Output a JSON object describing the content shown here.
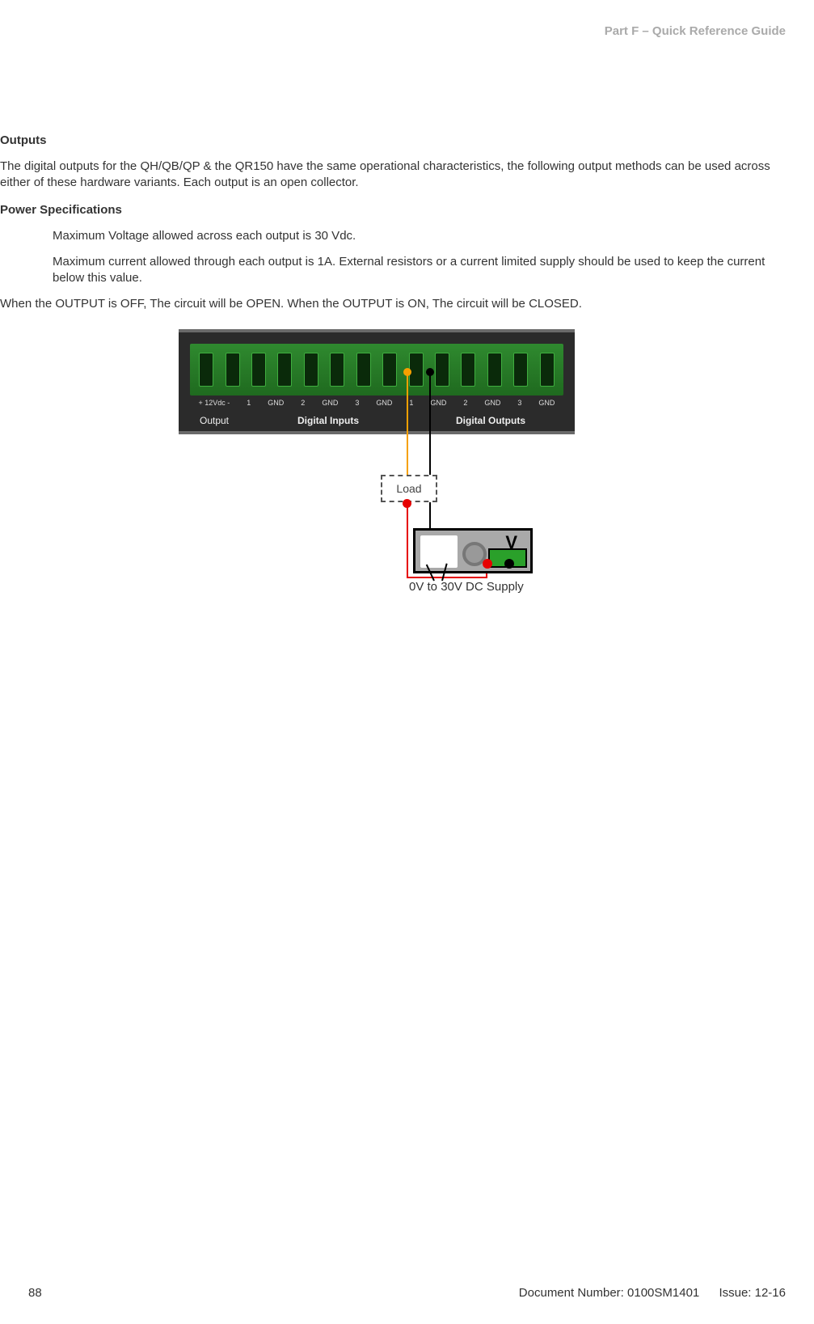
{
  "header": {
    "part_title": "Part F – Quick Reference Guide"
  },
  "sections": {
    "outputs_heading": "Outputs",
    "outputs_para": "The digital outputs for the QH/QB/QP & the QR150 have the same operational characteristics, the following output methods can be used across either of these hardware variants. Each output is an open collector.",
    "power_spec_heading": "Power Specifications",
    "spec_voltage": "Maximum Voltage allowed across each output is 30 Vdc.",
    "spec_current": "Maximum current allowed through each output is 1A. External resistors or a current limited supply should be used to keep the current below this value.",
    "state_para": "When the OUTPUT is OFF, The circuit will be OPEN. When the OUTPUT is ON, The circuit will be CLOSED."
  },
  "diagram": {
    "terminal_pin_labels": [
      "+ 12Vdc -",
      "1",
      "GND",
      "2",
      "GND",
      "3",
      "GND",
      "1",
      "GND",
      "2",
      "GND",
      "3",
      "GND"
    ],
    "section_labels": {
      "output": "Output",
      "digital_inputs": "Digital Inputs",
      "digital_outputs": "Digital Outputs"
    },
    "load_label": "Load",
    "meter_unit": "V",
    "meter_plus": "+",
    "meter_minus": "-",
    "supply_label": "0V to 30V DC Supply"
  },
  "footer": {
    "page_number": "88",
    "doc_number_label": "Document Number: 0100SM1401",
    "issue_label": "Issue: 12-16"
  }
}
